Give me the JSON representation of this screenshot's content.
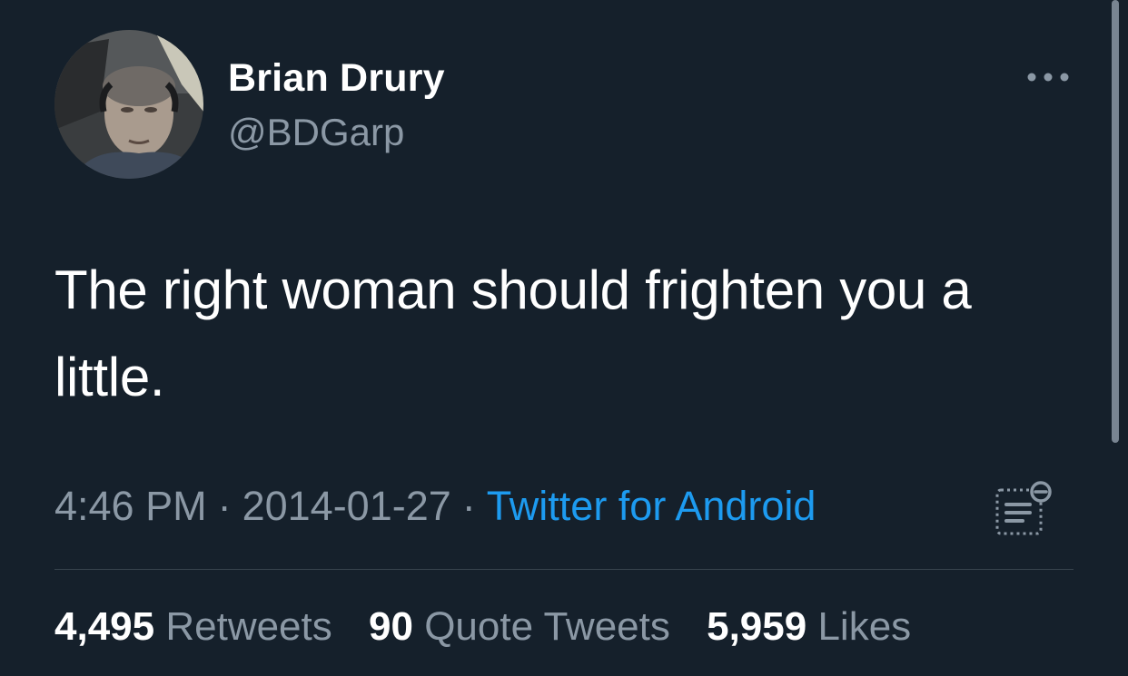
{
  "author": {
    "display_name": "Brian Drury",
    "handle": "@BDGarp"
  },
  "tweet": {
    "text": "The right woman should frighten you a little.",
    "time": "4:46 PM",
    "date": "2014-01-27",
    "separator": "·",
    "source": "Twitter for Android"
  },
  "stats": {
    "retweets": {
      "count": "4,495",
      "label": "Retweets"
    },
    "quote_tweets": {
      "count": "90",
      "label": "Quote Tweets"
    },
    "likes": {
      "count": "5,959",
      "label": "Likes"
    }
  },
  "icons": {
    "more": "more-horizontal-icon",
    "notes": "notes-icon"
  },
  "colors": {
    "background": "#15202b",
    "primary_text": "#ffffff",
    "secondary_text": "#8b98a5",
    "link": "#1d9bf0",
    "divider": "#38444d"
  }
}
